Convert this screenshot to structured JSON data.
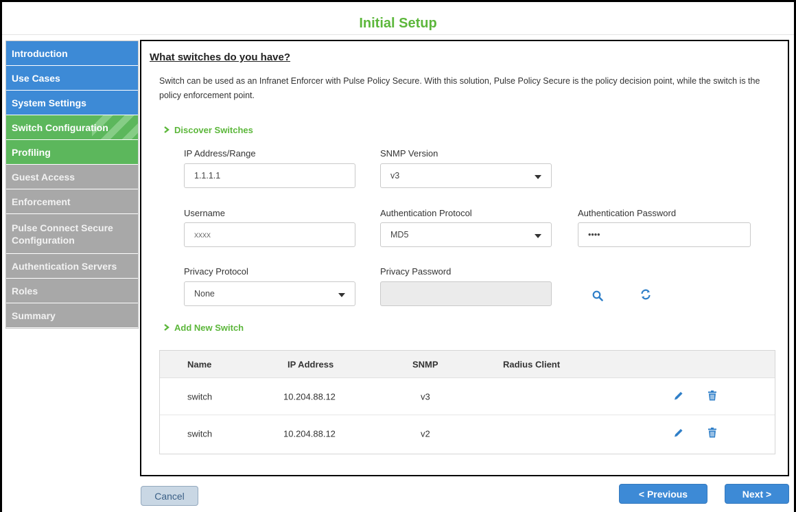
{
  "title": "Initial Setup",
  "sidebar": {
    "items": [
      {
        "label": "Introduction"
      },
      {
        "label": "Use Cases"
      },
      {
        "label": "System Settings"
      },
      {
        "label": "Switch Configuration"
      },
      {
        "label": "Profiling"
      },
      {
        "label": "Guest Access"
      },
      {
        "label": "Enforcement"
      },
      {
        "label": "Pulse Connect Secure Configuration"
      },
      {
        "label": "Authentication Servers"
      },
      {
        "label": "Roles"
      },
      {
        "label": "Summary"
      }
    ]
  },
  "main": {
    "heading": "What switches do you have?",
    "description": "Switch can be used as an Infranet Enforcer with Pulse Policy Secure. With this solution, Pulse Policy Secure is the policy decision point, while the switch is the policy enforcement point.",
    "discover": {
      "heading": "Discover Switches",
      "ip_label": "IP Address/Range",
      "ip_value": "1.1.1.1",
      "snmp_label": "SNMP Version",
      "snmp_value": "v3",
      "username_label": "Username",
      "username_value": "xxxx",
      "auth_protocol_label": "Authentication Protocol",
      "auth_protocol_value": "MD5",
      "auth_password_label": "Authentication Password",
      "auth_password_value": "••••",
      "privacy_protocol_label": "Privacy Protocol",
      "privacy_protocol_value": "None",
      "privacy_password_label": "Privacy Password",
      "privacy_password_value": ""
    },
    "add_new": {
      "heading": "Add New Switch"
    },
    "table": {
      "headers": {
        "name": "Name",
        "ip": "IP Address",
        "snmp": "SNMP",
        "radius": "Radius Client"
      },
      "rows": [
        {
          "name": "switch",
          "ip": "10.204.88.12",
          "snmp": "v3",
          "radius": ""
        },
        {
          "name": "switch",
          "ip": "10.204.88.12",
          "snmp": "v2",
          "radius": ""
        }
      ]
    }
  },
  "footer": {
    "cancel": "Cancel",
    "previous": "< Previous",
    "next": "Next >"
  },
  "icons": {
    "search": "search-icon",
    "refresh": "refresh-icon",
    "edit": "pencil-icon",
    "delete": "trash-icon",
    "chevron": "chevron-right-icon"
  },
  "colors": {
    "accent_green": "#5cb73b",
    "nav_blue": "#3d8ad6",
    "nav_gray": "#a8a8a8",
    "icon_blue": "#2f7fc8"
  }
}
